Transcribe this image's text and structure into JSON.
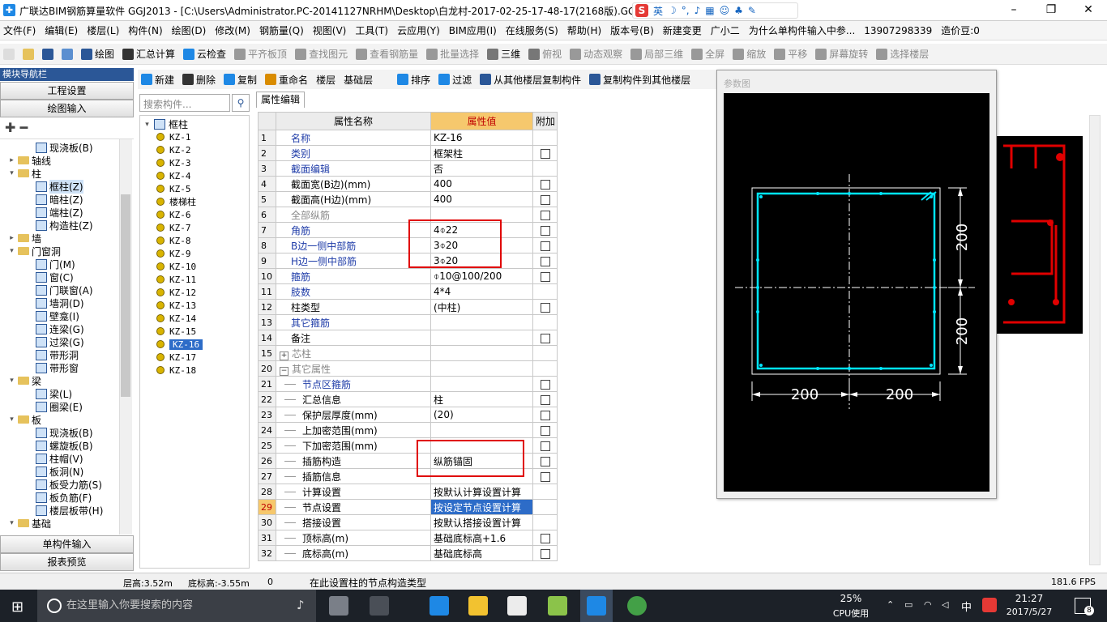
{
  "window": {
    "title": "广联达BIM钢筋算量软件 GGJ2013 - [C:\\Users\\Administrator.PC-20141127NRHM\\Desktop\\白龙村-2017-02-25-17-48-17(2168版).GGJ1",
    "ime_mode": "英"
  },
  "menu": [
    "文件(F)",
    "编辑(E)",
    "楼层(L)",
    "构件(N)",
    "绘图(D)",
    "修改(M)",
    "钢筋量(Q)",
    "视图(V)",
    "工具(T)",
    "云应用(Y)",
    "BIM应用(I)",
    "在线服务(S)",
    "帮助(H)",
    "版本号(B)",
    "新建变更",
    "广小二",
    "为什么单构件输入中参...",
    "13907298339",
    "造价豆:0"
  ],
  "toolbar1": [
    "绘图",
    "汇总计算",
    "云检查",
    "平齐板顶",
    "查找图元",
    "查看钢筋量",
    "批量选择",
    "三维",
    "俯视",
    "动态观察",
    "局部三维",
    "全屏",
    "缩放",
    "平移",
    "屏幕旋转",
    "选择楼层"
  ],
  "nav": {
    "header": "模块导航栏",
    "btn_project": "工程设置",
    "btn_draw": "绘图输入",
    "btn_single": "单构件输入",
    "btn_report": "报表预览",
    "tree": [
      {
        "label": "现浇板(B)",
        "level": 2
      },
      {
        "label": "轴线",
        "level": 0,
        "folder": true
      },
      {
        "label": "柱",
        "level": 0,
        "folder": true,
        "open": true
      },
      {
        "label": "框柱(Z)",
        "level": 2,
        "selected": true
      },
      {
        "label": "暗柱(Z)",
        "level": 2
      },
      {
        "label": "端柱(Z)",
        "level": 2
      },
      {
        "label": "构造柱(Z)",
        "level": 2
      },
      {
        "label": "墙",
        "level": 0,
        "folder": true
      },
      {
        "label": "门窗洞",
        "level": 0,
        "folder": true,
        "open": true
      },
      {
        "label": "门(M)",
        "level": 2
      },
      {
        "label": "窗(C)",
        "level": 2
      },
      {
        "label": "门联窗(A)",
        "level": 2
      },
      {
        "label": "墙洞(D)",
        "level": 2
      },
      {
        "label": "壁龛(I)",
        "level": 2
      },
      {
        "label": "连梁(G)",
        "level": 2
      },
      {
        "label": "过梁(G)",
        "level": 2
      },
      {
        "label": "带形洞",
        "level": 2
      },
      {
        "label": "带形窗",
        "level": 2
      },
      {
        "label": "梁",
        "level": 0,
        "folder": true,
        "open": true
      },
      {
        "label": "梁(L)",
        "level": 2
      },
      {
        "label": "圈梁(E)",
        "level": 2
      },
      {
        "label": "板",
        "level": 0,
        "folder": true,
        "open": true
      },
      {
        "label": "现浇板(B)",
        "level": 2
      },
      {
        "label": "螺旋板(B)",
        "level": 2
      },
      {
        "label": "柱帽(V)",
        "level": 2
      },
      {
        "label": "板洞(N)",
        "level": 2
      },
      {
        "label": "板受力筋(S)",
        "level": 2
      },
      {
        "label": "板负筋(F)",
        "level": 2
      },
      {
        "label": "楼层板带(H)",
        "level": 2
      },
      {
        "label": "基础",
        "level": 0,
        "folder": true,
        "open": true
      }
    ]
  },
  "toolbar2": [
    "新建",
    "删除",
    "复制",
    "重命名",
    "楼层",
    "基础层",
    "排序",
    "过滤",
    "从其他楼层复制构件",
    "复制构件到其他楼层"
  ],
  "search": {
    "placeholder": "搜索构件..."
  },
  "components": {
    "root": "框柱",
    "items": [
      "KZ-1",
      "KZ-2",
      "KZ-3",
      "KZ-4",
      "KZ-5",
      "楼梯柱",
      "KZ-6",
      "KZ-7",
      "KZ-8",
      "KZ-9",
      "KZ-10",
      "KZ-11",
      "KZ-12",
      "KZ-13",
      "KZ-14",
      "KZ-15",
      "KZ-16",
      "KZ-17",
      "KZ-18"
    ],
    "selected": "KZ-16"
  },
  "props": {
    "tab": "属性编辑",
    "col_name": "属性名称",
    "col_value": "属性值",
    "col_extra": "附加",
    "rows": [
      {
        "n": "1",
        "name": "名称",
        "value": "KZ-16",
        "style": "blue",
        "chk": false,
        "indent": 0
      },
      {
        "n": "2",
        "name": "类别",
        "value": "框架柱",
        "style": "blue",
        "chk": true,
        "indent": 0
      },
      {
        "n": "3",
        "name": "截面编辑",
        "value": "否",
        "style": "blue",
        "chk": false,
        "indent": 0
      },
      {
        "n": "4",
        "name": "截面宽(B边)(mm)",
        "value": "400",
        "style": "",
        "chk": true,
        "indent": 0
      },
      {
        "n": "5",
        "name": "截面高(H边)(mm)",
        "value": "400",
        "style": "",
        "chk": true,
        "indent": 0
      },
      {
        "n": "6",
        "name": "全部纵筋",
        "value": "",
        "style": "gray",
        "chk": true,
        "indent": 0
      },
      {
        "n": "7",
        "name": "角筋",
        "value": "4⌽22",
        "style": "blue",
        "chk": true,
        "indent": 0
      },
      {
        "n": "8",
        "name": "B边一侧中部筋",
        "value": "3⌽20",
        "style": "blue",
        "chk": true,
        "indent": 0
      },
      {
        "n": "9",
        "name": "H边一侧中部筋",
        "value": "3⌽20",
        "style": "blue",
        "chk": true,
        "indent": 0
      },
      {
        "n": "10",
        "name": "箍筋",
        "value": "⌽10@100/200",
        "style": "blue",
        "chk": true,
        "indent": 0
      },
      {
        "n": "11",
        "name": "肢数",
        "value": "4*4",
        "style": "blue",
        "chk": false,
        "indent": 0
      },
      {
        "n": "12",
        "name": "柱类型",
        "value": "(中柱)",
        "style": "",
        "chk": true,
        "indent": 0
      },
      {
        "n": "13",
        "name": "其它箍筋",
        "value": "",
        "style": "blue",
        "chk": false,
        "indent": 0
      },
      {
        "n": "14",
        "name": "备注",
        "value": "",
        "style": "",
        "chk": true,
        "indent": 0
      },
      {
        "n": "15",
        "name": "芯柱",
        "value": "",
        "style": "gray",
        "chk": false,
        "indent": 0,
        "expander": "+"
      },
      {
        "n": "20",
        "name": "其它属性",
        "value": "",
        "style": "gray",
        "chk": false,
        "indent": 0,
        "expander": "−"
      },
      {
        "n": "21",
        "name": "节点区箍筋",
        "value": "",
        "style": "blue",
        "chk": true,
        "indent": 1
      },
      {
        "n": "22",
        "name": "汇总信息",
        "value": "柱",
        "style": "",
        "chk": true,
        "indent": 1
      },
      {
        "n": "23",
        "name": "保护层厚度(mm)",
        "value": "(20)",
        "style": "",
        "chk": true,
        "indent": 1
      },
      {
        "n": "24",
        "name": "上加密范围(mm)",
        "value": "",
        "style": "",
        "chk": true,
        "indent": 1
      },
      {
        "n": "25",
        "name": "下加密范围(mm)",
        "value": "",
        "style": "",
        "chk": true,
        "indent": 1
      },
      {
        "n": "26",
        "name": "插筋构造",
        "value": "纵筋锚固",
        "style": "",
        "chk": true,
        "indent": 1
      },
      {
        "n": "27",
        "name": "插筋信息",
        "value": "",
        "style": "",
        "chk": true,
        "indent": 1
      },
      {
        "n": "28",
        "name": "计算设置",
        "value": "按默认计算设置计算",
        "style": "",
        "chk": false,
        "indent": 1
      },
      {
        "n": "29",
        "name": "节点设置",
        "value": "按设定节点设置计算",
        "style": "sel",
        "chk": false,
        "indent": 1
      },
      {
        "n": "30",
        "name": "搭接设置",
        "value": "按默认搭接设置计算",
        "style": "",
        "chk": false,
        "indent": 1
      },
      {
        "n": "31",
        "name": "顶标高(m)",
        "value": "基础底标高+1.6",
        "style": "",
        "chk": true,
        "indent": 1
      },
      {
        "n": "32",
        "name": "底标高(m)",
        "value": "基础底标高",
        "style": "",
        "chk": true,
        "indent": 1
      }
    ]
  },
  "dialog": {
    "title": "参数图",
    "dim_right_top": "200",
    "dim_right_bottom": "200",
    "dim_bottom_left": "200",
    "dim_bottom_right": "200"
  },
  "status": {
    "floor_height": "层高:3.52m",
    "bottom_elev": "底标高:-3.55m",
    "count": "0",
    "hint": "在此设置柱的节点构造类型",
    "fps": "181.6 FPS"
  },
  "taskbar": {
    "search_placeholder": "在这里输入你要搜索的内容",
    "cpu_pct": "25%",
    "cpu_label": "CPU使用",
    "lang": "中",
    "time": "21:27",
    "date": "2017/5/27",
    "notif_count": "8"
  },
  "colors": {
    "accent": "#2b5797",
    "highlight_header": "#f6c86d",
    "red_box": "#e00000",
    "cad_cyan": "#00e5ff"
  }
}
